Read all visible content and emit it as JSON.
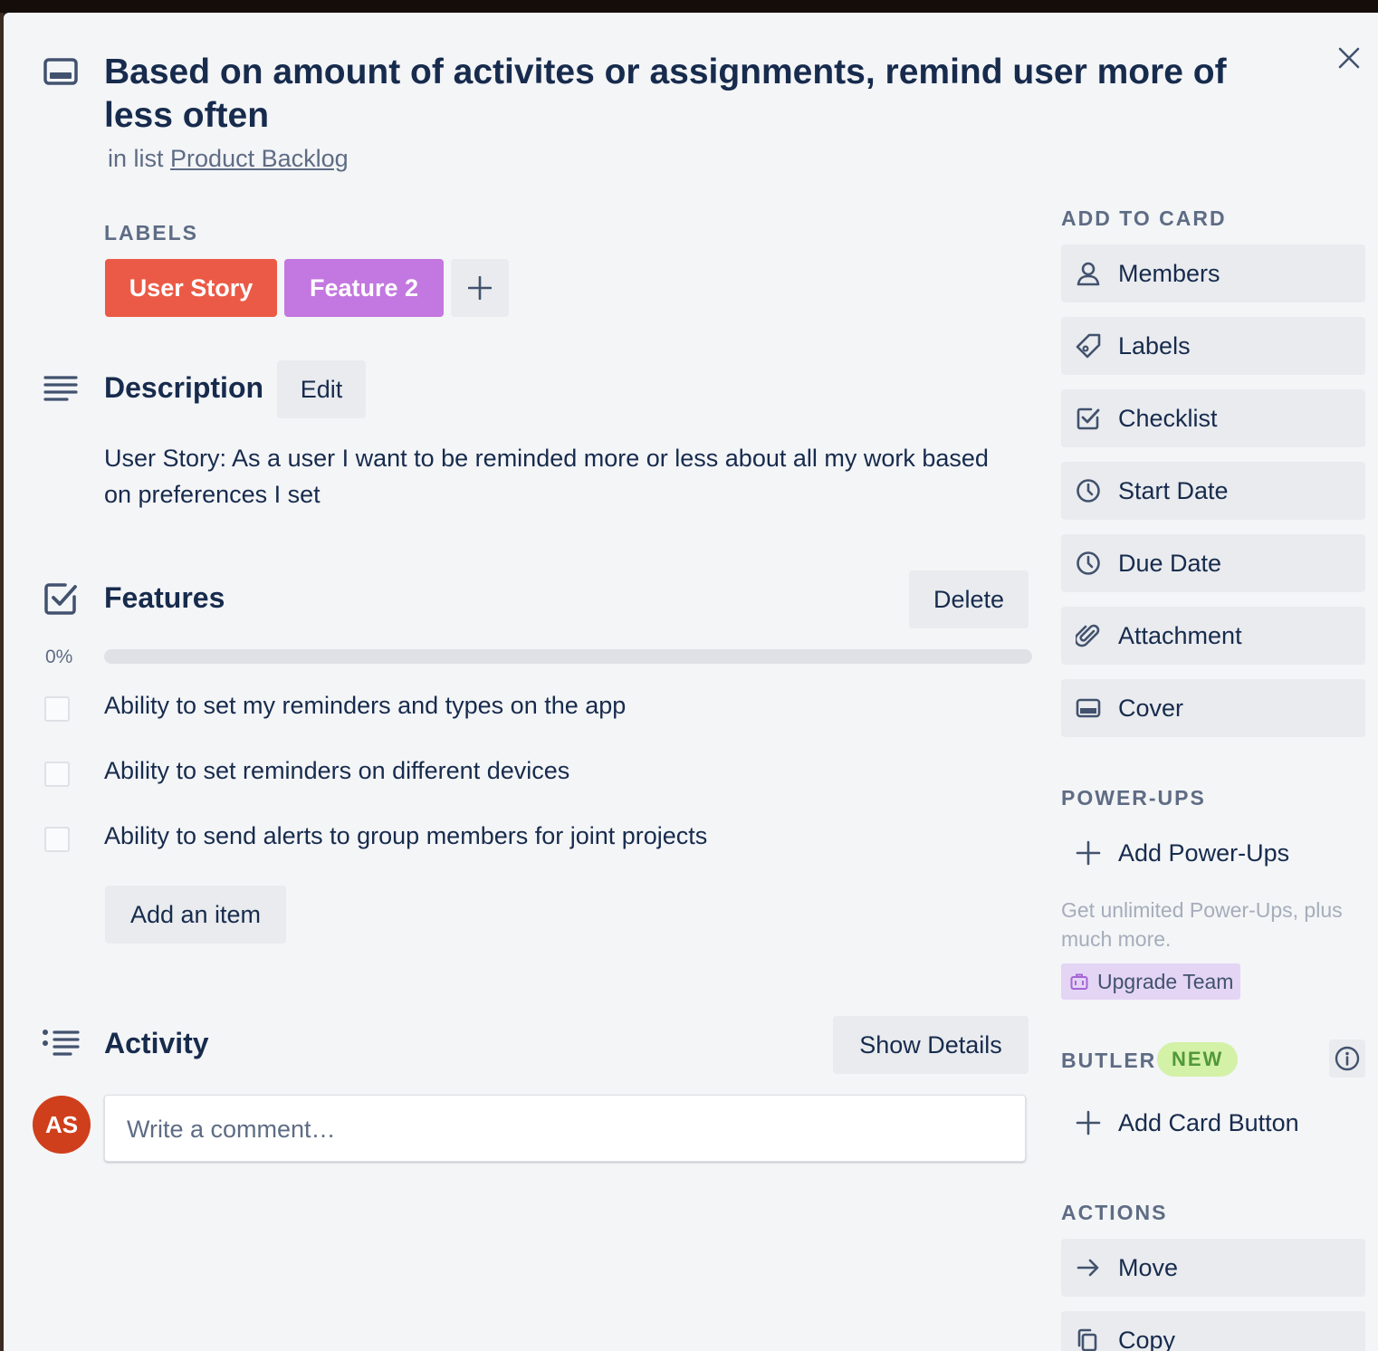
{
  "card": {
    "title": "Based on amount of activites or assignments, remind user more of less often",
    "in_list_prefix": "in list",
    "list_name": "Product Backlog"
  },
  "labels": {
    "heading": "LABELS",
    "items": [
      {
        "text": "User Story",
        "color": "#eb5a46"
      },
      {
        "text": "Feature 2",
        "color": "#c377e0"
      }
    ],
    "add_symbol": "+"
  },
  "description": {
    "heading": "Description",
    "edit_label": "Edit",
    "text": "User Story: As a user I want to be reminded more or less about all my work based on preferences I set"
  },
  "checklist": {
    "heading": "Features",
    "delete_label": "Delete",
    "progress_text": "0%",
    "progress_fraction": 0,
    "items": [
      {
        "text": "Ability to set my reminders and types on the app",
        "checked": false
      },
      {
        "text": "Ability to set reminders on different devices",
        "checked": false
      },
      {
        "text": "Ability to send alerts to group members for joint projects",
        "checked": false
      }
    ],
    "add_item_label": "Add an item"
  },
  "activity": {
    "heading": "Activity",
    "show_details_label": "Show Details",
    "avatar_initials": "AS",
    "comment_placeholder": "Write a comment…"
  },
  "sidebar": {
    "add_to_card": {
      "heading": "ADD TO CARD",
      "items": [
        {
          "label": "Members",
          "icon": "person-icon"
        },
        {
          "label": "Labels",
          "icon": "tag-icon"
        },
        {
          "label": "Checklist",
          "icon": "checklist-icon"
        },
        {
          "label": "Start Date",
          "icon": "clock-icon"
        },
        {
          "label": "Due Date",
          "icon": "clock-icon"
        },
        {
          "label": "Attachment",
          "icon": "paperclip-icon"
        },
        {
          "label": "Cover",
          "icon": "card-cover-icon"
        }
      ]
    },
    "power_ups": {
      "heading": "POWER-UPS",
      "add_label": "Add Power-Ups",
      "promo_text": "Get unlimited Power-Ups, plus much more.",
      "upgrade_label": "Upgrade Team"
    },
    "butler": {
      "heading": "BUTLER",
      "badge": "NEW",
      "add_card_button_label": "Add Card Button"
    },
    "actions": {
      "heading": "ACTIONS",
      "items": [
        {
          "label": "Move",
          "icon": "arrow-right-icon"
        },
        {
          "label": "Copy",
          "icon": "copy-icon"
        }
      ]
    }
  },
  "colors": {
    "text_primary": "#172b4d",
    "text_subtle": "#5e6c84",
    "button_bg": "#e9ebee",
    "modal_bg": "#f4f5f7",
    "avatar_bg": "#cf3f1c",
    "progress_fill": "#61bd4f"
  }
}
